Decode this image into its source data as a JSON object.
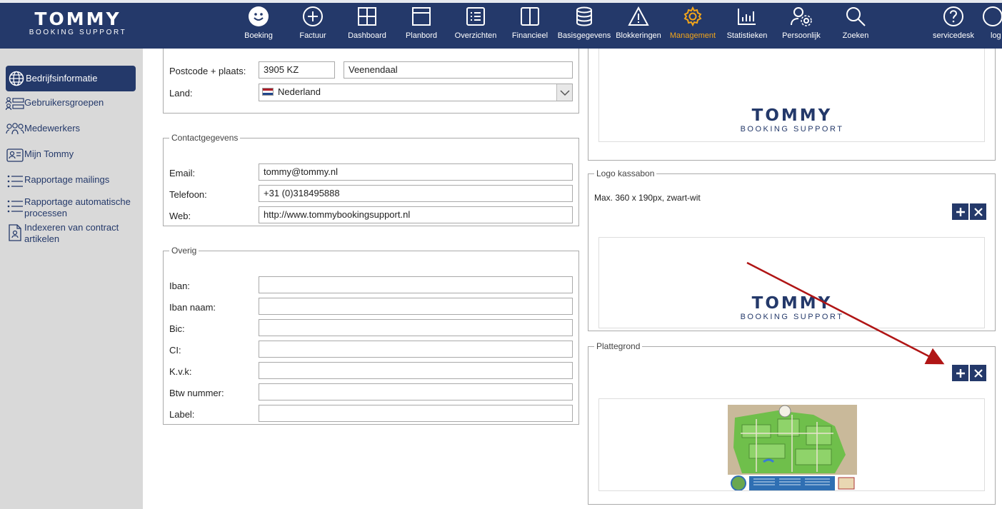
{
  "brand": {
    "name": "TOMMY",
    "tagline": "BOOKING SUPPORT"
  },
  "nav": [
    {
      "label": "Boeking",
      "icon": "smiley-icon",
      "active": false
    },
    {
      "label": "Factuur",
      "icon": "plus-circle-icon",
      "active": false
    },
    {
      "label": "Dashboard",
      "icon": "dashboard-icon",
      "active": false
    },
    {
      "label": "Planbord",
      "icon": "planbord-icon",
      "active": false
    },
    {
      "label": "Overzichten",
      "icon": "list-icon",
      "active": false
    },
    {
      "label": "Financieel",
      "icon": "book-icon",
      "active": false
    },
    {
      "label": "Basisgegevens",
      "icon": "database-icon",
      "active": false
    },
    {
      "label": "Blokkeringen",
      "icon": "warning-icon",
      "active": false
    },
    {
      "label": "Management",
      "icon": "gear-icon",
      "active": true,
      "color": "#f2a51a"
    },
    {
      "label": "Statistieken",
      "icon": "bar-chart-icon",
      "active": false
    },
    {
      "label": "Persoonlijk",
      "icon": "user-gear-icon",
      "active": false
    },
    {
      "label": "Zoeken",
      "icon": "search-icon",
      "active": false
    },
    {
      "label": "servicedesk",
      "icon": "help-icon",
      "active": false
    },
    {
      "label": "log",
      "icon": "logout-icon",
      "active": false
    }
  ],
  "sidebar": {
    "items": [
      {
        "label": "Bedrijfsinformatie",
        "icon": "globe-icon",
        "active": true
      },
      {
        "label": "Gebruikersgroepen",
        "icon": "user-groups-icon"
      },
      {
        "label": "Medewerkers",
        "icon": "people-icon"
      },
      {
        "label": "Mijn Tommy",
        "icon": "id-card-icon"
      },
      {
        "label": "Rapportage mailings",
        "icon": "list-icon"
      },
      {
        "label": "Rapportage automatische processen",
        "icon": "list-icon"
      },
      {
        "label": "Indexeren van contract artikelen",
        "icon": "document-user-icon"
      }
    ]
  },
  "address": {
    "postcode_label": "Postcode + plaats:",
    "postcode": "3905 KZ",
    "city": "Veenendaal",
    "country_label": "Land:",
    "country": "Nederland"
  },
  "contact": {
    "legend": "Contactgegevens",
    "email_label": "Email:",
    "email": "tommy@tommy.nl",
    "phone_label": "Telefoon:",
    "phone": "+31 (0)318495888",
    "web_label": "Web:",
    "web": "http://www.tommybookingsupport.nl"
  },
  "other": {
    "legend": "Overig",
    "fields": [
      {
        "label": "Iban:",
        "value": ""
      },
      {
        "label": "Iban naam:",
        "value": ""
      },
      {
        "label": "Bic:",
        "value": ""
      },
      {
        "label": "CI:",
        "value": ""
      },
      {
        "label": "K.v.k:",
        "value": ""
      },
      {
        "label": "Btw nummer:",
        "value": ""
      },
      {
        "label": "Label:",
        "value": ""
      }
    ]
  },
  "logo_kassabon": {
    "legend": "Logo kassabon",
    "note": "Max. 360 x 190px, zwart-wit",
    "add_label": "+",
    "remove_label": "×"
  },
  "plattegrond": {
    "legend": "Plattegrond",
    "add_label": "+",
    "remove_label": "×"
  },
  "colors": {
    "navy": "#24396a",
    "active_nav": "#f2a51a",
    "sidebar_bg": "#d9d9d9",
    "arrow": "#b01515"
  }
}
